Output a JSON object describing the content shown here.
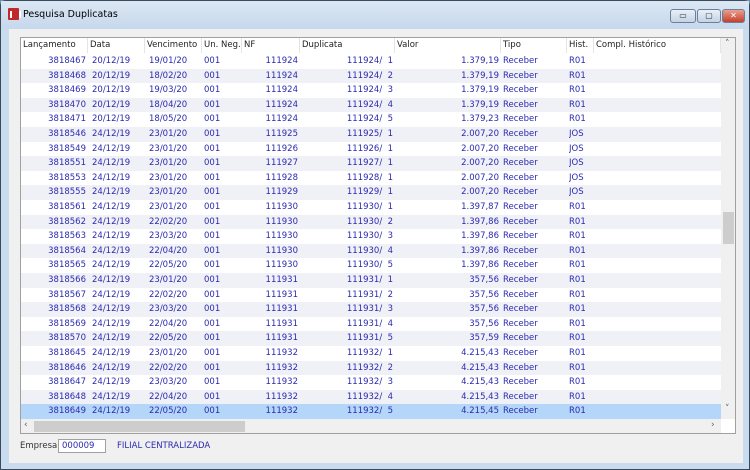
{
  "window": {
    "title": "Pesquisa Duplicatas",
    "minimize": "▭",
    "maximize": "▢",
    "close": "✕"
  },
  "columns": [
    "Lançamento",
    "Data",
    "Vencimento",
    "Un. Neg.",
    "NF",
    "Duplicata",
    "Valor",
    "Tipo",
    "Hist.",
    "Compl. Histórico"
  ],
  "rows": [
    [
      "3818467",
      "20/12/19",
      "19/01/20",
      "001",
      "111924",
      "111924/  1",
      "1.379,19",
      "Receber",
      "R01",
      ""
    ],
    [
      "3818468",
      "20/12/19",
      "18/02/20",
      "001",
      "111924",
      "111924/  2",
      "1.379,19",
      "Receber",
      "R01",
      ""
    ],
    [
      "3818469",
      "20/12/19",
      "19/03/20",
      "001",
      "111924",
      "111924/  3",
      "1.379,19",
      "Receber",
      "R01",
      ""
    ],
    [
      "3818470",
      "20/12/19",
      "18/04/20",
      "001",
      "111924",
      "111924/  4",
      "1.379,19",
      "Receber",
      "R01",
      ""
    ],
    [
      "3818471",
      "20/12/19",
      "18/05/20",
      "001",
      "111924",
      "111924/  5",
      "1.379,23",
      "Receber",
      "R01",
      ""
    ],
    [
      "3818546",
      "24/12/19",
      "23/01/20",
      "001",
      "111925",
      "111925/  1",
      "2.007,20",
      "Receber",
      "JOS",
      ""
    ],
    [
      "3818549",
      "24/12/19",
      "23/01/20",
      "001",
      "111926",
      "111926/  1",
      "2.007,20",
      "Receber",
      "JOS",
      ""
    ],
    [
      "3818551",
      "24/12/19",
      "23/01/20",
      "001",
      "111927",
      "111927/  1",
      "2.007,20",
      "Receber",
      "JOS",
      ""
    ],
    [
      "3818553",
      "24/12/19",
      "23/01/20",
      "001",
      "111928",
      "111928/  1",
      "2.007,20",
      "Receber",
      "JOS",
      ""
    ],
    [
      "3818555",
      "24/12/19",
      "23/01/20",
      "001",
      "111929",
      "111929/  1",
      "2.007,20",
      "Receber",
      "JOS",
      ""
    ],
    [
      "3818561",
      "24/12/19",
      "23/01/20",
      "001",
      "111930",
      "111930/  1",
      "1.397,87",
      "Receber",
      "R01",
      ""
    ],
    [
      "3818562",
      "24/12/19",
      "22/02/20",
      "001",
      "111930",
      "111930/  2",
      "1.397,86",
      "Receber",
      "R01",
      ""
    ],
    [
      "3818563",
      "24/12/19",
      "23/03/20",
      "001",
      "111930",
      "111930/  3",
      "1.397,86",
      "Receber",
      "R01",
      ""
    ],
    [
      "3818564",
      "24/12/19",
      "22/04/20",
      "001",
      "111930",
      "111930/  4",
      "1.397,86",
      "Receber",
      "R01",
      ""
    ],
    [
      "3818565",
      "24/12/19",
      "22/05/20",
      "001",
      "111930",
      "111930/  5",
      "1.397,86",
      "Receber",
      "R01",
      ""
    ],
    [
      "3818566",
      "24/12/19",
      "23/01/20",
      "001",
      "111931",
      "111931/  1",
      "357,56",
      "Receber",
      "R01",
      ""
    ],
    [
      "3818567",
      "24/12/19",
      "22/02/20",
      "001",
      "111931",
      "111931/  2",
      "357,56",
      "Receber",
      "R01",
      ""
    ],
    [
      "3818568",
      "24/12/19",
      "23/03/20",
      "001",
      "111931",
      "111931/  3",
      "357,56",
      "Receber",
      "R01",
      ""
    ],
    [
      "3818569",
      "24/12/19",
      "22/04/20",
      "001",
      "111931",
      "111931/  4",
      "357,56",
      "Receber",
      "R01",
      ""
    ],
    [
      "3818570",
      "24/12/19",
      "22/05/20",
      "001",
      "111931",
      "111931/  5",
      "357,59",
      "Receber",
      "R01",
      ""
    ],
    [
      "3818645",
      "24/12/19",
      "23/01/20",
      "001",
      "111932",
      "111932/  1",
      "4.215,43",
      "Receber",
      "R01",
      ""
    ],
    [
      "3818646",
      "24/12/19",
      "22/02/20",
      "001",
      "111932",
      "111932/  2",
      "4.215,43",
      "Receber",
      "R01",
      ""
    ],
    [
      "3818647",
      "24/12/19",
      "23/03/20",
      "001",
      "111932",
      "111932/  3",
      "4.215,43",
      "Receber",
      "R01",
      ""
    ],
    [
      "3818648",
      "24/12/19",
      "22/04/20",
      "001",
      "111932",
      "111932/  4",
      "4.215,43",
      "Receber",
      "R01",
      ""
    ],
    [
      "3818649",
      "24/12/19",
      "22/05/20",
      "001",
      "111932",
      "111932/  5",
      "4.215,45",
      "Receber",
      "R01",
      ""
    ]
  ],
  "selected_row": 24,
  "footer": {
    "empresa_label": "Empresa",
    "empresa_value": "000009",
    "empresa_name": "FILIAL CENTRALIZADA"
  },
  "colors": {
    "text": "#2a2ab0",
    "selected": "#b4d6f8",
    "alt_row": "#f0f0f7"
  }
}
